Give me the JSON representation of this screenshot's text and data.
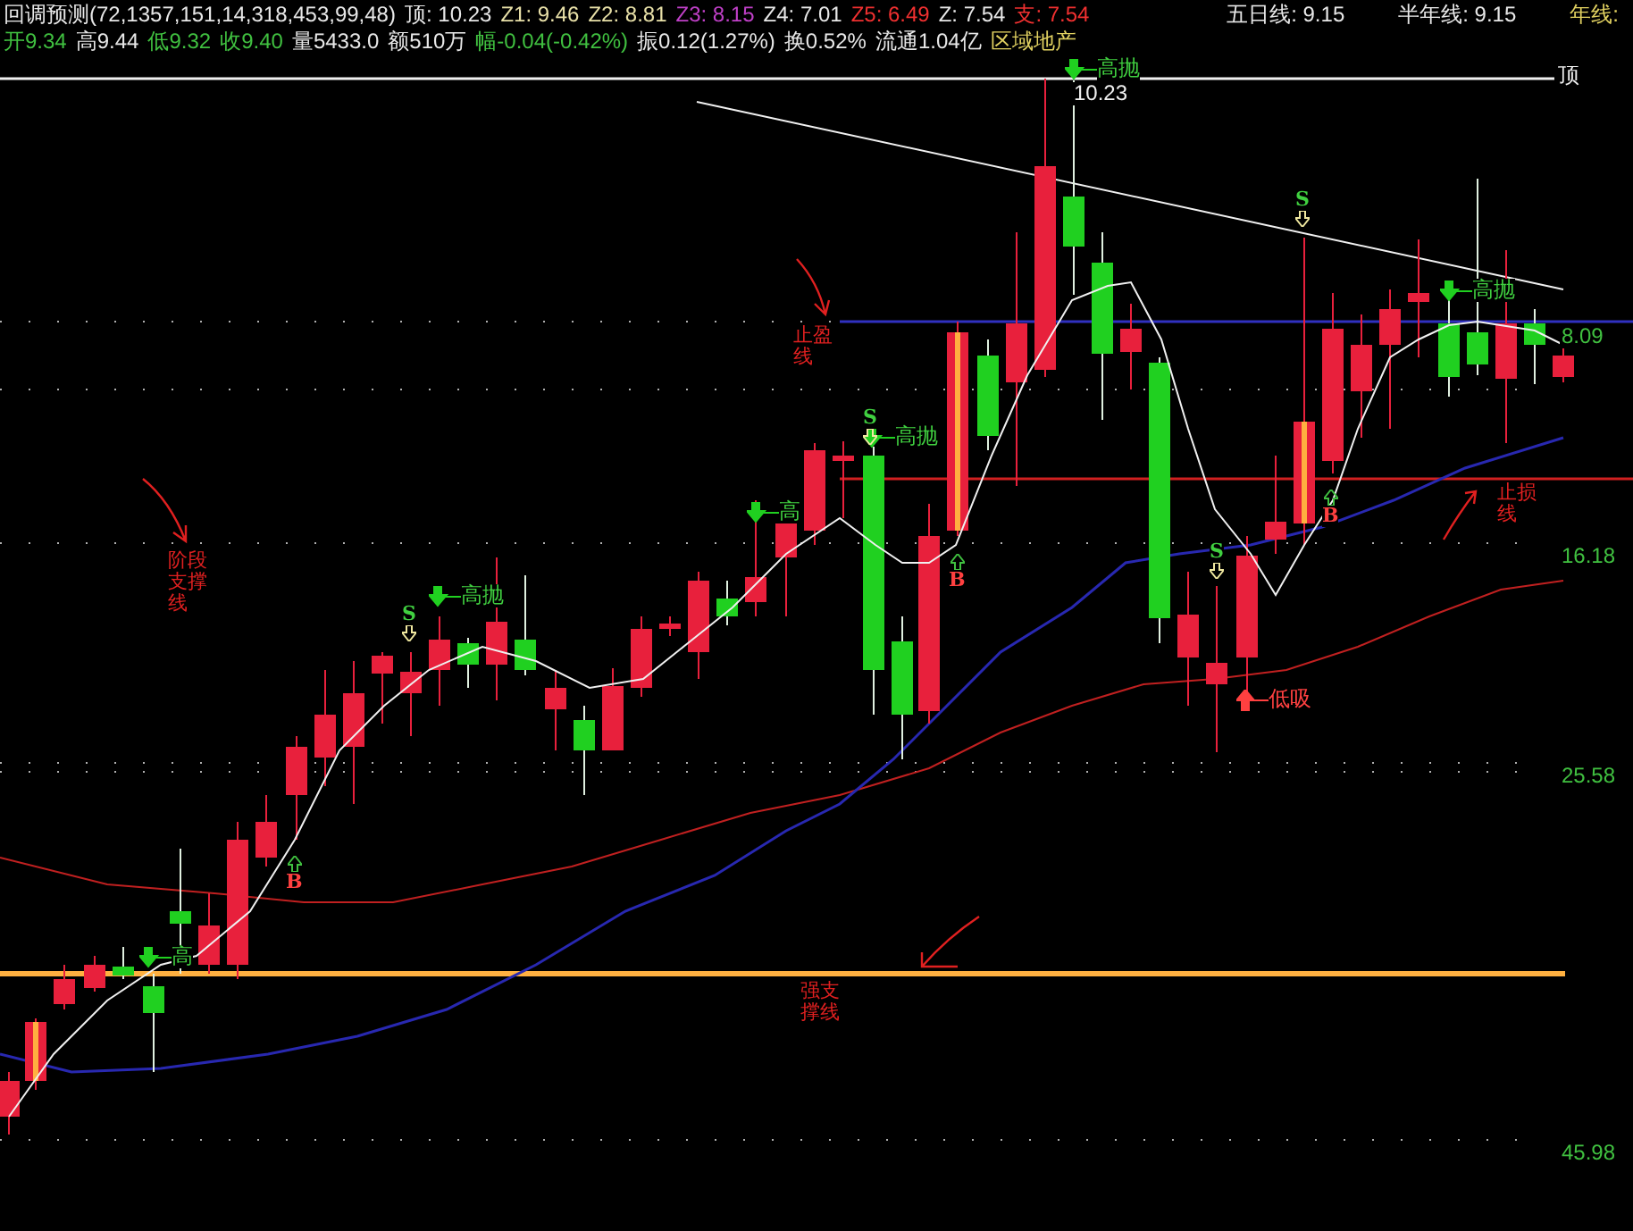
{
  "header": {
    "title": "回调预测(72,1357,151,14,318,453,99,48)",
    "indicators": [
      {
        "label": "顶: 10.23",
        "color": "#e8e8e8"
      },
      {
        "label": "Z1: 9.46",
        "color": "#e8e0a8"
      },
      {
        "label": "Z2: 8.81",
        "color": "#e8e0a8"
      },
      {
        "label": "Z3: 8.15",
        "color": "#c040c8"
      },
      {
        "label": "Z4: 7.01",
        "color": "#e8e8e8"
      },
      {
        "label": "Z5: 6.49",
        "color": "#f03030"
      },
      {
        "label": "Z: 7.54",
        "color": "#e8e8e8"
      },
      {
        "label": "支: 7.54",
        "color": "#f03030"
      }
    ],
    "moving_averages": [
      {
        "label": "五日线: 9.15",
        "color": "#e8e8e8"
      },
      {
        "label": "半年线: 9.15",
        "color": "#e8e8e8"
      },
      {
        "label": "年线:",
        "color": "#e0d060"
      }
    ],
    "quote": [
      {
        "label": "开9.34",
        "color": "#40c040"
      },
      {
        "label": "高9.44",
        "color": "#e8e8e8"
      },
      {
        "label": "低9.32",
        "color": "#40c040"
      },
      {
        "label": "收9.40",
        "color": "#40c040"
      },
      {
        "label": "量5433.0",
        "color": "#e8e8e8"
      },
      {
        "label": "额510万",
        "color": "#e8e8e8"
      },
      {
        "label": "幅-0.04(-0.42%)",
        "color": "#40c040"
      },
      {
        "label": "振0.12(1.27%)",
        "color": "#e8e8e8"
      },
      {
        "label": "换0.52%",
        "color": "#e8e8e8"
      },
      {
        "label": "流通1.04亿",
        "color": "#e8e8e8"
      },
      {
        "label": "区域地产",
        "color": "#e0d060"
      }
    ]
  },
  "price_labels": [
    "8.09",
    "16.18",
    "25.58",
    "45.98"
  ],
  "signals": [
    {
      "kind": "sell",
      "text": "高抛"
    },
    {
      "kind": "price",
      "text": "10.23"
    },
    {
      "kind": "sell",
      "text": "高抛"
    },
    {
      "kind": "sell",
      "text": "高"
    },
    {
      "kind": "sell",
      "text": "高抛"
    },
    {
      "kind": "sell",
      "text": "高抛"
    },
    {
      "kind": "sell",
      "text": "高"
    },
    {
      "kind": "s",
      "text": "S"
    },
    {
      "kind": "s",
      "text": "S"
    },
    {
      "kind": "s",
      "text": "S"
    },
    {
      "kind": "s",
      "text": "S"
    },
    {
      "kind": "b",
      "text": "B"
    },
    {
      "kind": "b",
      "text": "B"
    },
    {
      "kind": "b",
      "text": "B"
    },
    {
      "kind": "buy",
      "text": "低吸"
    },
    {
      "kind": "top",
      "text": "顶"
    }
  ],
  "annotations": [
    "阶段支撑线",
    "止盈线",
    "止损线",
    "强支撑线"
  ]
}
